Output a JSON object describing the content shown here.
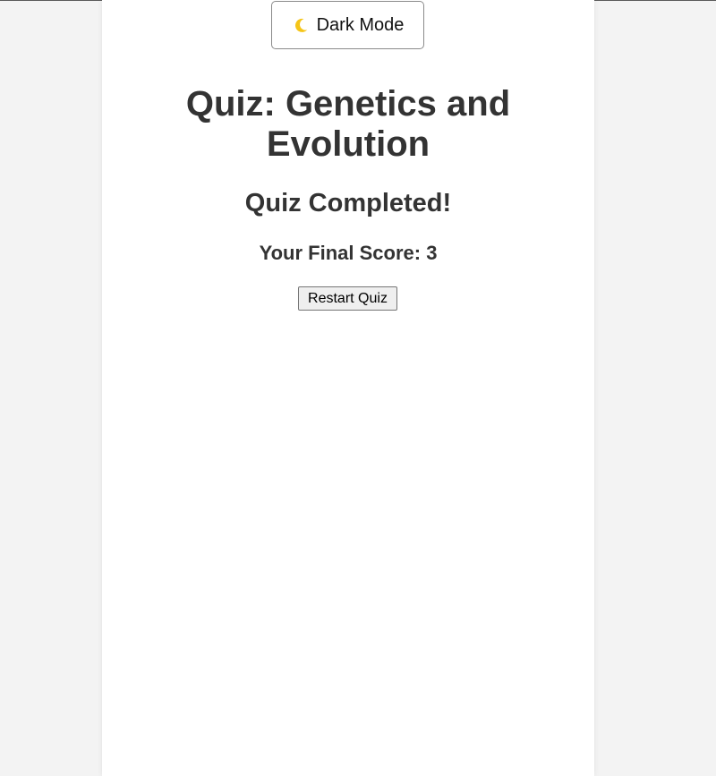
{
  "header": {
    "theme_toggle_label": "Dark Mode",
    "theme_toggle_icon": "moon-icon"
  },
  "quiz": {
    "title": "Quiz: Genetics and Evolution",
    "completed_heading": "Quiz Completed!",
    "score_label": "Your Final Score: ",
    "score_value": "3",
    "restart_label": "Restart Quiz"
  },
  "colors": {
    "page_background": "#f3f3f3",
    "card_background": "#ffffff",
    "text": "#333333",
    "moon": "#f5c518"
  }
}
